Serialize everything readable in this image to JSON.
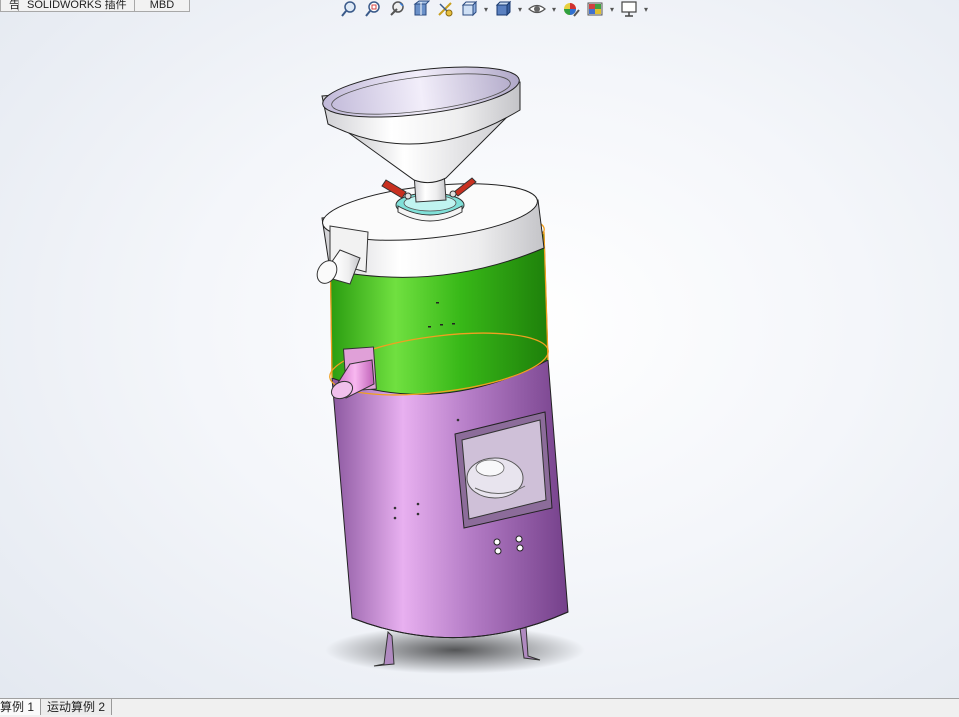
{
  "top_tabs": [
    "告",
    "SOLIDWORKS 插件",
    "MBD"
  ],
  "bottom_tabs": [
    "算例 1",
    "运动算例 2"
  ],
  "toolbar": {
    "icons": [
      "zoom-to-fit-icon",
      "zoom-to-area-icon",
      "previous-view-icon",
      "section-view-icon",
      "dynamic-annotation-icon",
      "view-orientation-icon",
      "display-style-icon",
      "hide-show-items-icon",
      "edit-appearance-icon",
      "apply-scene-icon",
      "view-settings-icon"
    ]
  },
  "colors": {
    "hopper": "#f2f2f4",
    "upper_shell": "#f5f5f6",
    "middle_shell": "#38b818",
    "lower_shell": "#b47cc6",
    "selection_edge": "#f0a020",
    "pink_spout": "#e890d8",
    "red_handle": "#c83020",
    "cyan_collar": "#80e0d8"
  }
}
